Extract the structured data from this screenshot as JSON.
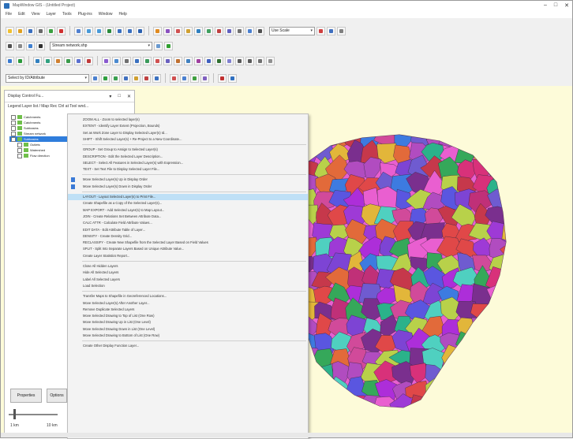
{
  "window": {
    "title": "MapWindow GIS - (Untitled Project)",
    "minimize_glyph": "–",
    "maximize_glyph": "□",
    "close_glyph": "✕"
  },
  "menubar": [
    "File",
    "Edit",
    "View",
    "Layer",
    "Tools",
    "Plug-ins",
    "Window",
    "Help"
  ],
  "toolbar": {
    "scale_combo_value": "Use Scale",
    "layer_combo_value": "Stream network.shp",
    "field_combo_value": "Select by ID/Attribute"
  },
  "panel": {
    "title": "Display Control Fu...",
    "tab_header": "Legend Layer list / Map Rec Ctrl at Tool wnd...",
    "tree_items": [
      {
        "label": "Catchments",
        "selected": false
      },
      {
        "label": "Catchments",
        "selected": false
      },
      {
        "label": "Subbasins",
        "selected": false
      },
      {
        "label": "Stream network",
        "selected": false
      },
      {
        "label": "Subbasins",
        "selected": true
      },
      {
        "label": "Outlets",
        "selected": false
      },
      {
        "label": "Watershed",
        "selected": false
      },
      {
        "label": "Flow direction",
        "selected": false
      }
    ],
    "buttons": [
      "Properties",
      "Options"
    ],
    "scale_min": "1 km",
    "scale_max": "10 km"
  },
  "context_menu": {
    "groups": [
      [
        "ZOOM ALL - Zoom to selected layer(s)",
        "EXTENT - Identify Layer Extent (Projection, Bounds)",
        "Set as Work Zone Layer to Display Selected Layer(s) Id...",
        "SHIFT - Shift Selected Layer(s) + Re-Project to a New Coordinate..."
      ],
      [
        "GROUP - Set Group to Assign to Selected Layer(s)",
        "DESCRIPTION - Edit the Selected Layer Description...",
        "SELECT - Select All Features in Selected Layer(s) with Expression...",
        "TEXT - Set Text File to Display Selected Layer File..."
      ],
      [
        "Move Selected Layer(s) Up in Display Order",
        "Move Selected Layer(s) Down in Display Order"
      ],
      [
        "LAYOUT - Layout Selected Layer(s) to Print File...",
        "Create Shapefile as a Copy of the Selected Layer(s)...",
        "MAP EXPORT - Add Selected Layer(s) to Map Layout...",
        "JOIN - Create Relations Set Between Attribute Data...",
        "CALC ATTR - Calculate Field Attribute Values...",
        "EDIT DATA - Edit Attribute Table of Layer...",
        "DENSITY - Create Density Grid...",
        "RECLASSIFY - Create New Shapefile from the Selected Layer Based on Field Values",
        "SPLIT - Split Into Separate Layers Based on Unique Attribute Value...",
        "Create Layer Statistics Report..."
      ],
      [
        "Close All Hidden Layers",
        "Hide All Selected Layers",
        "Label All Selected Layers",
        "Load Selection"
      ],
      [
        "Transfer Maps to Shapefile in Georeferenced Locations...",
        "Move Selected Layer(s) After Another Layer...",
        "Remove Duplicate Selected Layers",
        "Move Selected Drawing to Top of List (One Row)",
        "Move Selected Drawing Up in List (One Level)",
        "Move Selected Drawing Down in List (One Level)",
        "Move Selected Drawing to Bottom of List (One Row)"
      ],
      [
        "Create Other Display Function Layer..."
      ]
    ],
    "highlighted_item": "LAYOUT - Layout Selected Layer(s) to Print File..."
  },
  "map_colors": [
    "#e95fd0",
    "#b14cc0",
    "#d8317a",
    "#6f5bd0",
    "#c6384b",
    "#7a2f8e",
    "#2bb28a",
    "#e26a3a",
    "#3d7be0",
    "#b8d14a",
    "#9e3ad6",
    "#4fd0c0",
    "#d14a9a",
    "#7d44d4",
    "#e2b63a",
    "#35a85a",
    "#c03078",
    "#5a56e0",
    "#e04848",
    "#ad2ed9"
  ]
}
